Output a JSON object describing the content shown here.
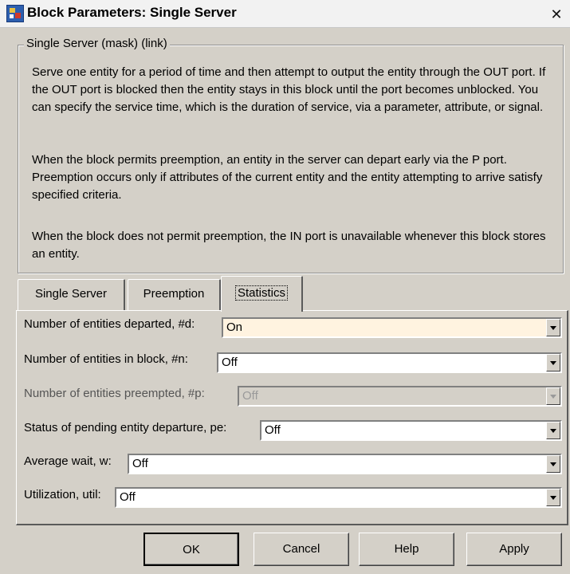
{
  "window": {
    "title": "Block Parameters: Single Server",
    "close_glyph": "✕"
  },
  "description": {
    "group_title": "Single Server (mask) (link)",
    "paragraphs": [
      "Serve one entity for a period of time and then attempt to output the entity through the OUT port. If the OUT port is blocked then the entity stays in this block until the port becomes unblocked. You can specify the service time, which is the duration of service, via a parameter, attribute, or signal.",
      "When the block permits preemption, an entity in the server can depart early via the P port. Preemption occurs only if attributes of the current entity and the entity attempting to arrive satisfy specified criteria.",
      "When the block does not permit preemption, the IN port is unavailable whenever this block stores an entity."
    ]
  },
  "tabs": [
    {
      "label": "Single Server",
      "active": false
    },
    {
      "label": "Preemption",
      "active": false
    },
    {
      "label": "Statistics",
      "active": true
    }
  ],
  "statistics": {
    "rows": [
      {
        "label": "Number of entities departed, #d:",
        "value": "On",
        "enabled": true
      },
      {
        "label": "Number of entities in block, #n:",
        "value": "Off",
        "enabled": true
      },
      {
        "label": "Number of entities preempted, #p:",
        "value": "Off",
        "enabled": false
      },
      {
        "label": "Status of pending entity departure, pe:",
        "value": "Off",
        "enabled": true
      },
      {
        "label": "Average wait, w:",
        "value": "Off",
        "enabled": true
      },
      {
        "label": "Utilization, util:",
        "value": "Off",
        "enabled": true
      }
    ]
  },
  "buttons": {
    "ok": "OK",
    "cancel": "Cancel",
    "help": "Help",
    "apply": "Apply"
  },
  "colors": {
    "dialog_bg": "#d4d0c8",
    "highlight_field": "#fff3e0"
  }
}
